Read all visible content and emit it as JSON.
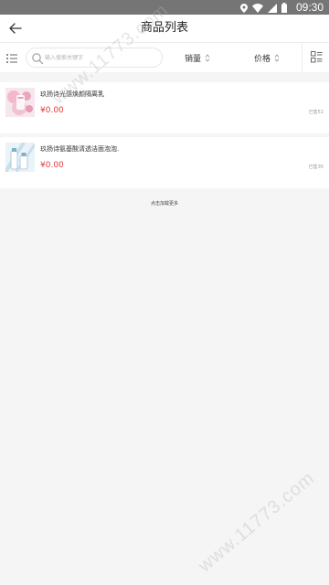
{
  "status_bar": {
    "time": "09:30",
    "icons": [
      "location-icon",
      "wifi-icon",
      "signal-icon",
      "battery-icon"
    ]
  },
  "header": {
    "title": "商品列表",
    "back_icon": "arrow-left-icon"
  },
  "filter_bar": {
    "search_placeholder": "输入搜索关键字",
    "sort_sales_label": "销量",
    "sort_price_label": "价格",
    "list_icon": "list-icon",
    "layout_icon": "grid-layout-icon"
  },
  "products": [
    {
      "name": "玖扬诗光感焕颜隔离乳",
      "price": "¥0.00",
      "sold": "已售51",
      "thumb_icon": "product-image-pink"
    },
    {
      "name": "玖扬诗氨基酸清透洁面泡泡.",
      "price": "¥0.00",
      "sold": "已售35",
      "thumb_icon": "product-image-blue"
    }
  ],
  "load_more": "点击加载更多",
  "watermark_text": "www.11773.com",
  "colors": {
    "price": "#e4393c",
    "status_bar": "#757575",
    "background": "#f5f5f5"
  }
}
